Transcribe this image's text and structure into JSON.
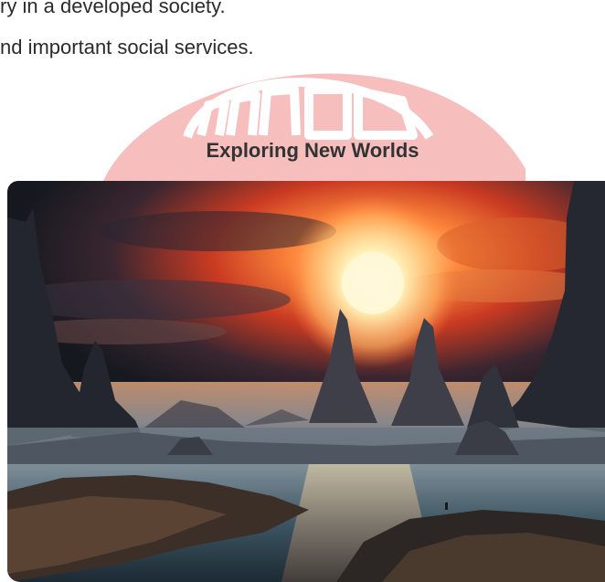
{
  "document": {
    "lines": [
      "ry in a developed society.",
      "nd important social services."
    ],
    "section_title": "Exploring New Worlds"
  },
  "figure": {
    "subject": "alien-planet-landscape"
  },
  "colors": {
    "watermark": "#f6b7b7",
    "text": "#2b2b2b",
    "title": "#333333",
    "sun": "#fff3c4",
    "sky_dark": "#1b1e2a",
    "sky_glow": "#e0532a"
  }
}
